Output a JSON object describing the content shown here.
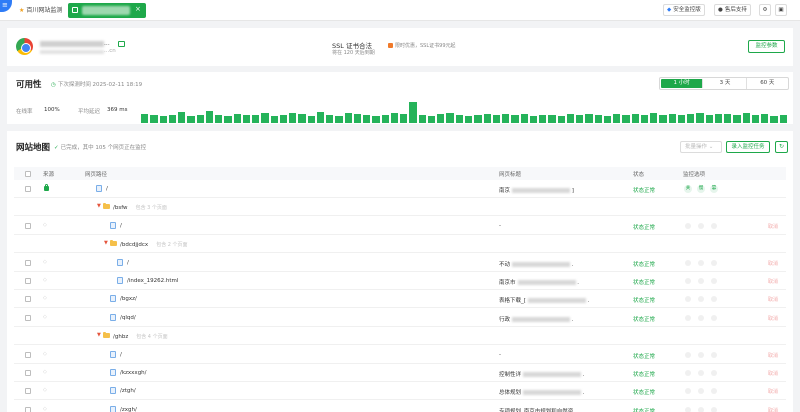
{
  "topbar": {
    "tabs": [
      {
        "label": "百川网站监测"
      }
    ],
    "buttons": [
      {
        "label": "安全监控版"
      },
      {
        "label": "售后支持"
      }
    ],
    "close_glyph": "×"
  },
  "site": {
    "name_suffix": "...",
    "url_suffix": "...cn",
    "ssl_title": "SSL 证书合法",
    "ssl_sub": "将在 120 天后到期",
    "promo": "限时优惠，SSL证书99元起",
    "settings_button": "监控参数"
  },
  "availability": {
    "title": "可用性",
    "next_probe": "下次探测时间 2025-02-11 18:19",
    "ranges": [
      "1 小时",
      "3 天",
      "60 天"
    ],
    "active_range": 0,
    "online_rate_label": "在线率",
    "online_rate_value": "100%",
    "avg_latency_label": "平均延迟",
    "avg_latency_value": "369 ms",
    "latency_bars": [
      8,
      7,
      6,
      7,
      10,
      6,
      7,
      11,
      7,
      6,
      8,
      7,
      7,
      9,
      6,
      7,
      9,
      8,
      6,
      10,
      7,
      6,
      9,
      8,
      7,
      6,
      7,
      9,
      8,
      19,
      7,
      6,
      8,
      9,
      7,
      6,
      7,
      8,
      7,
      8,
      7,
      8,
      6,
      7,
      7,
      6,
      8,
      7,
      8,
      7,
      6,
      8,
      7,
      8,
      7,
      9,
      7,
      8,
      7,
      8,
      9,
      7,
      8,
      8,
      7,
      9,
      7,
      8,
      6,
      7
    ]
  },
  "sitemap": {
    "title": "网站地图",
    "status": "已完成，其中 105 个网页正在监控",
    "batch_label": "批量操作",
    "add_task": "录入监控任务",
    "refresh_glyph": "↻",
    "columns": {
      "source": "来源",
      "path": "网页路径",
      "page_title": "网页标题",
      "status": "状态",
      "monitor": "监控选项"
    },
    "monitor_tags": [
      "关",
      "慢",
      "篡"
    ],
    "op_label": "取消",
    "rows": [
      {
        "type": "page",
        "path": "/",
        "title": "南京",
        "title_tail": "]",
        "status": "状态正常"
      },
      {
        "type": "folder",
        "path": "/bsfw",
        "count": "包含 3 个页面"
      },
      {
        "type": "page",
        "path": "/",
        "title": "-",
        "status": "状态正常"
      },
      {
        "type": "folder",
        "path": "/bdcdjjdcx",
        "count": "包含 2 个页面"
      },
      {
        "type": "page",
        "path": "/",
        "title": "不动",
        "title_tail": ".",
        "status": "状态正常"
      },
      {
        "type": "page",
        "path": "/index_19262.html",
        "title": "南京市",
        "title_tail": ".",
        "status": "状态正常"
      },
      {
        "type": "page",
        "path": "/bgxz/",
        "title": "表格下载_[",
        "title_tail": ".",
        "status": "状态正常"
      },
      {
        "type": "page",
        "path": "/qlqd/",
        "title": "行政",
        "title_tail": ".",
        "status": "状态正常"
      },
      {
        "type": "folder",
        "path": "/ghbz",
        "count": "包含 4 个页面"
      },
      {
        "type": "page",
        "path": "/",
        "title": "-",
        "status": "状态正常"
      },
      {
        "type": "page",
        "path": "/kzxxxgh/",
        "title": "控制性详",
        "title_tail": ".",
        "status": "状态正常"
      },
      {
        "type": "page",
        "path": "/ztgh/",
        "title": "总体规划",
        "title_tail": ".",
        "status": "状态正常"
      },
      {
        "type": "page",
        "path": "/zxgh/",
        "title": "专项规划_南京市规划和自然资",
        "status": "状态正常"
      }
    ]
  }
}
